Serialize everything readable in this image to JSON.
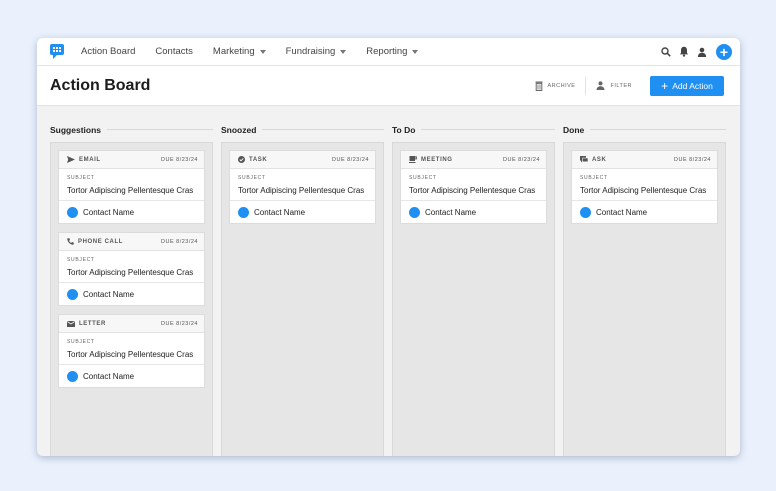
{
  "nav": {
    "items": [
      {
        "label": "Action Board",
        "dropdown": false
      },
      {
        "label": "Contacts",
        "dropdown": false
      },
      {
        "label": "Marketing",
        "dropdown": true
      },
      {
        "label": "Fundraising",
        "dropdown": true
      },
      {
        "label": "Reporting",
        "dropdown": true
      }
    ]
  },
  "header": {
    "title": "Action Board",
    "archive_label": "ARCHIVE",
    "filter_label": "FILTER",
    "add_label": "Add Action",
    "add_icon": "+"
  },
  "columns": [
    {
      "title": "Suggestions",
      "cards": [
        {
          "type": "EMAIL",
          "icon": "send-icon",
          "due": "DUE 8/23/24",
          "subject_label": "SUBJECT",
          "subject": "Tortor Adipiscing Pellentesque Cras",
          "contact": "Contact Name"
        },
        {
          "type": "PHONE CALL",
          "icon": "phone-icon",
          "due": "DUE 8/23/24",
          "subject_label": "SUBJECT",
          "subject": "Tortor Adipiscing Pellentesque Cras",
          "contact": "Contact Name"
        },
        {
          "type": "LETTER",
          "icon": "mail-icon",
          "due": "DUE 8/23/24",
          "subject_label": "SUBJECT",
          "subject": "Tortor Adipiscing Pellentesque Cras",
          "contact": "Contact Name"
        }
      ]
    },
    {
      "title": "Snoozed",
      "cards": [
        {
          "type": "TASK",
          "icon": "check-circle-icon",
          "due": "DUE 8/23/24",
          "subject_label": "SUBJECT",
          "subject": "Tortor Adipiscing Pellentesque Cras",
          "contact": "Contact Name"
        }
      ]
    },
    {
      "title": "To Do",
      "cards": [
        {
          "type": "MEETING",
          "icon": "coffee-icon",
          "due": "DUE 8/23/24",
          "subject_label": "SUBJECT",
          "subject": "Tortor Adipiscing Pellentesque Cras",
          "contact": "Contact Name"
        }
      ]
    },
    {
      "title": "Done",
      "cards": [
        {
          "type": "ASK",
          "icon": "chat-icon",
          "due": "DUE 8/23/24",
          "subject_label": "SUBJECT",
          "subject": "Tortor Adipiscing Pellentesque Cras",
          "contact": "Contact Name"
        }
      ]
    }
  ],
  "colors": {
    "accent": "#1f8ff1",
    "background": "#eaf1fd",
    "board": "#f2f2f2"
  }
}
